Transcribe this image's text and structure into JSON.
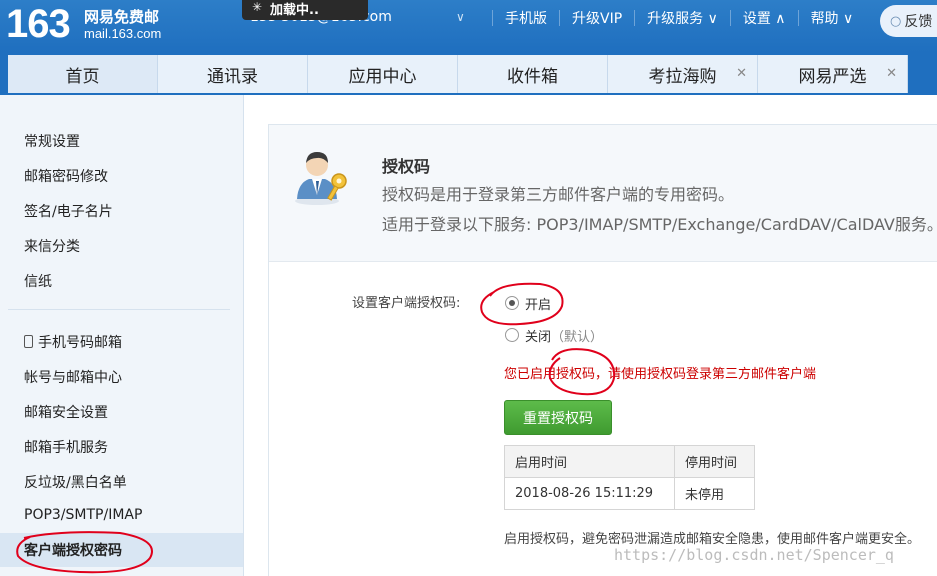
{
  "header": {
    "logo_number": "163",
    "logo_title": "网易免费邮",
    "logo_domain": "mail.163.com",
    "loading_text": "加载中..",
    "account": "153 3015@163.com",
    "links": [
      "手机版",
      "升级VIP",
      "升级服务",
      "设置",
      "帮助"
    ],
    "feedback": "反馈"
  },
  "tabs": [
    {
      "label": "首页",
      "closable": false
    },
    {
      "label": "通讯录",
      "closable": false
    },
    {
      "label": "应用中心",
      "closable": false
    },
    {
      "label": "收件箱",
      "closable": false
    },
    {
      "label": "考拉海购",
      "closable": true
    },
    {
      "label": "网易严选",
      "closable": true
    }
  ],
  "sidebar": {
    "group1": [
      "常规设置",
      "邮箱密码修改",
      "签名/电子名片",
      "来信分类",
      "信纸"
    ],
    "group2": [
      "手机号码邮箱",
      "帐号与邮箱中心",
      "邮箱安全设置",
      "邮箱手机服务",
      "反垃圾/黑白名单",
      "POP3/SMTP/IMAP",
      "客户端授权密码"
    ]
  },
  "panel": {
    "title": "授权码",
    "desc1": "授权码是用于登录第三方邮件客户端的专用密码。",
    "desc2": "适用于登录以下服务: POP3/IMAP/SMTP/Exchange/CardDAV/CalDAV服务。",
    "setting_label": "设置客户端授权码:",
    "option_on": "开启",
    "option_off": "关闭",
    "option_off_note": "（默认）",
    "notice": "您已启用授权码，请使用授权码登录第三方邮件客户端",
    "reset_button": "重置授权码",
    "table_headers": [
      "启用时间",
      "停用时间"
    ],
    "table_row": [
      "2018-08-26 15:11:29",
      "未停用"
    ],
    "footnote": "启用授权码，避免密码泄漏造成邮箱安全隐患，使用邮件客户端更安全。"
  },
  "watermark": "https://blog.csdn.net/Spencer_q",
  "colors": {
    "header_blue": "#1f6fbf",
    "annotation_red": "#e0001b",
    "notice_red": "#cc0000",
    "button_green": "#4caf3a"
  }
}
